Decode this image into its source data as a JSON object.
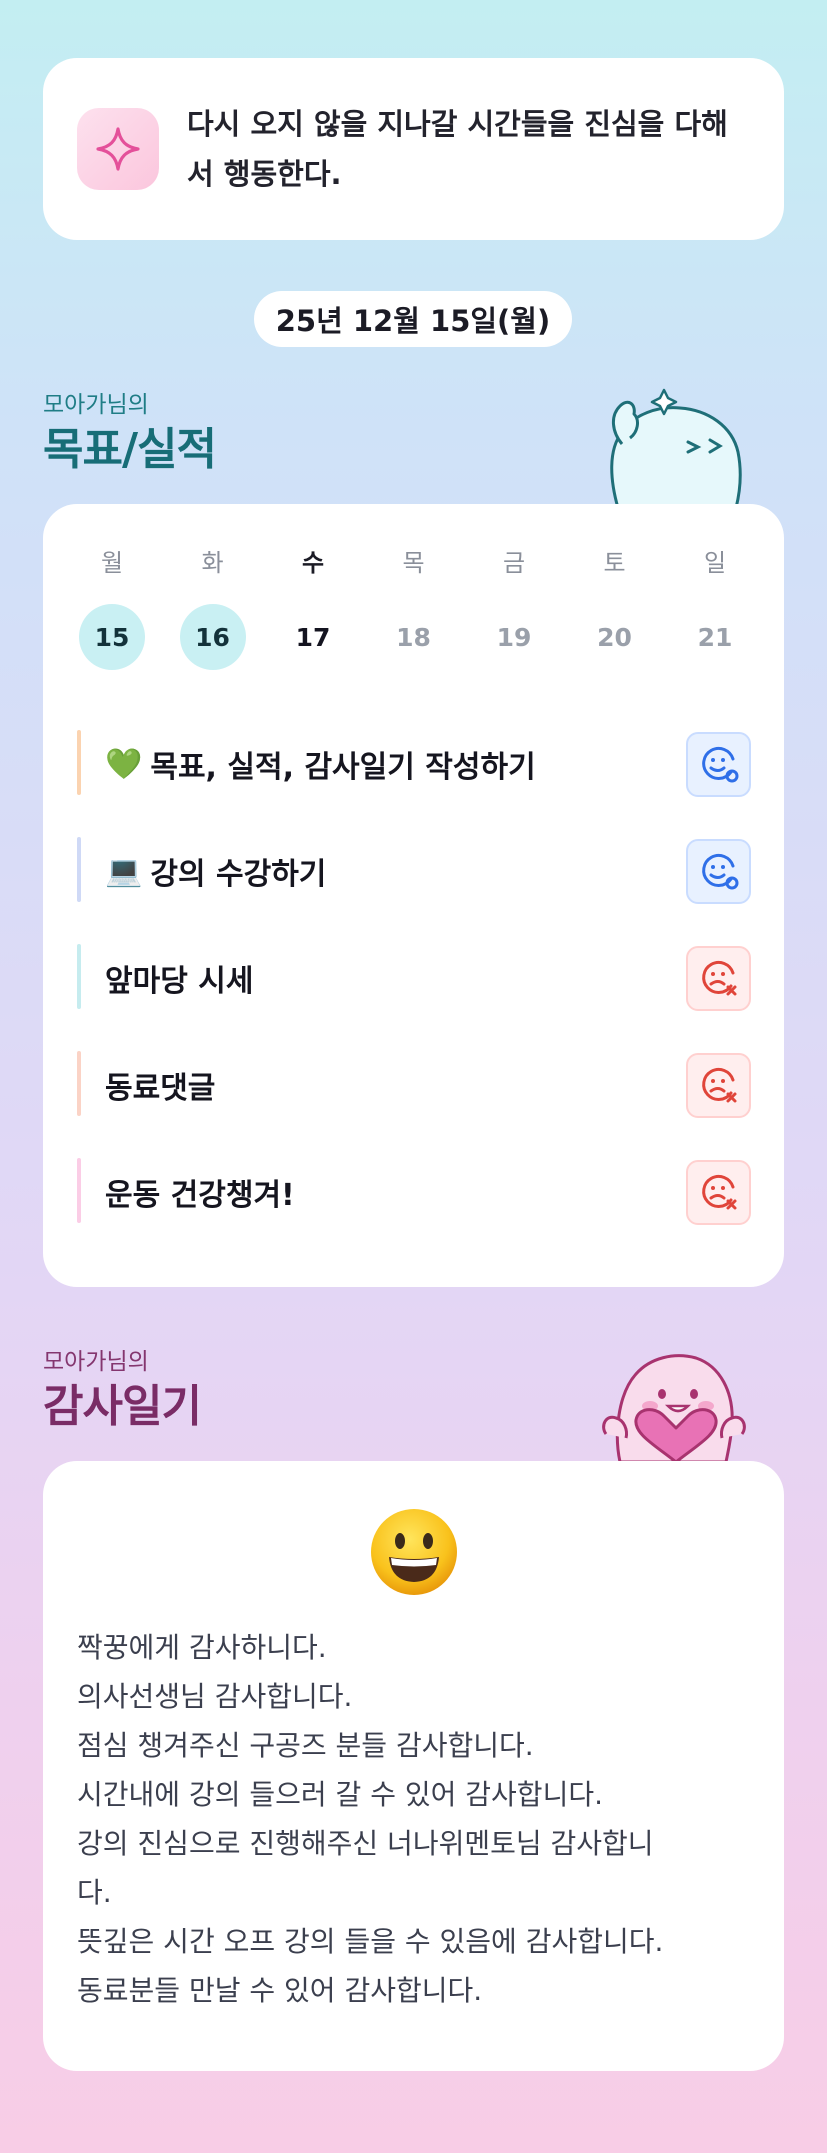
{
  "motto": {
    "icon": "sparkle-icon",
    "text": "다시 오지 않을 지나갈 시간들을 진심을 다해서 행동한다."
  },
  "date_label": "25년 12월 15일(월)",
  "goals_section": {
    "subtitle": "모아가님의",
    "title": "목표/실적"
  },
  "week": [
    {
      "day": "월",
      "date": "15",
      "state": "done"
    },
    {
      "day": "화",
      "date": "16",
      "state": "done"
    },
    {
      "day": "수",
      "date": "17",
      "state": "today"
    },
    {
      "day": "목",
      "date": "18",
      "state": "future"
    },
    {
      "day": "금",
      "date": "19",
      "state": "future"
    },
    {
      "day": "토",
      "date": "20",
      "state": "future"
    },
    {
      "day": "일",
      "date": "21",
      "state": "future"
    }
  ],
  "goals": [
    {
      "emoji": "💚",
      "label": "목표, 실적, 감사일기 작성하기",
      "status": "done",
      "bar_color": "#fbd3b0",
      "status_icon": "smile-check-icon"
    },
    {
      "emoji": "💻",
      "label": "강의 수강하기",
      "status": "done",
      "bar_color": "#cfd9f6",
      "status_icon": "smile-check-icon"
    },
    {
      "emoji": "",
      "label": "앞마당 시세",
      "status": "fail",
      "bar_color": "#c6ecef",
      "status_icon": "sad-x-icon"
    },
    {
      "emoji": "",
      "label": "동료댓글",
      "status": "fail",
      "bar_color": "#fbd3c6",
      "status_icon": "sad-x-icon"
    },
    {
      "emoji": "",
      "label": "운동 건강챙겨!",
      "status": "fail",
      "bar_color": "#fbcde6",
      "status_icon": "sad-x-icon"
    }
  ],
  "thanks_section": {
    "subtitle": "모아가님의",
    "title": "감사일기",
    "mood_icon": "grinning-face-icon",
    "lines": [
      "짝꿍에게 감사하니다.",
      "의사선생님 감사합니다.",
      "점심 챙겨주신 구공즈 분들 감사합니다.",
      "시간내에 강의 들으러 갈 수 있어 감사합니다.",
      "강의 진심으로 진행해주신 너나위멘토님 감사합니",
      "다.",
      "뜻깊은 시간 오프 강의 들을 수 있음에 감사합니다.",
      "동료분들 만날 수 있어 감사합니다."
    ]
  },
  "colors": {
    "done_circle": "#c9f0f3",
    "ok_icon": "#2f6fe8",
    "fail_icon": "#e0453a",
    "goals_title": "#176d77",
    "thanks_title": "#7a2c66"
  }
}
